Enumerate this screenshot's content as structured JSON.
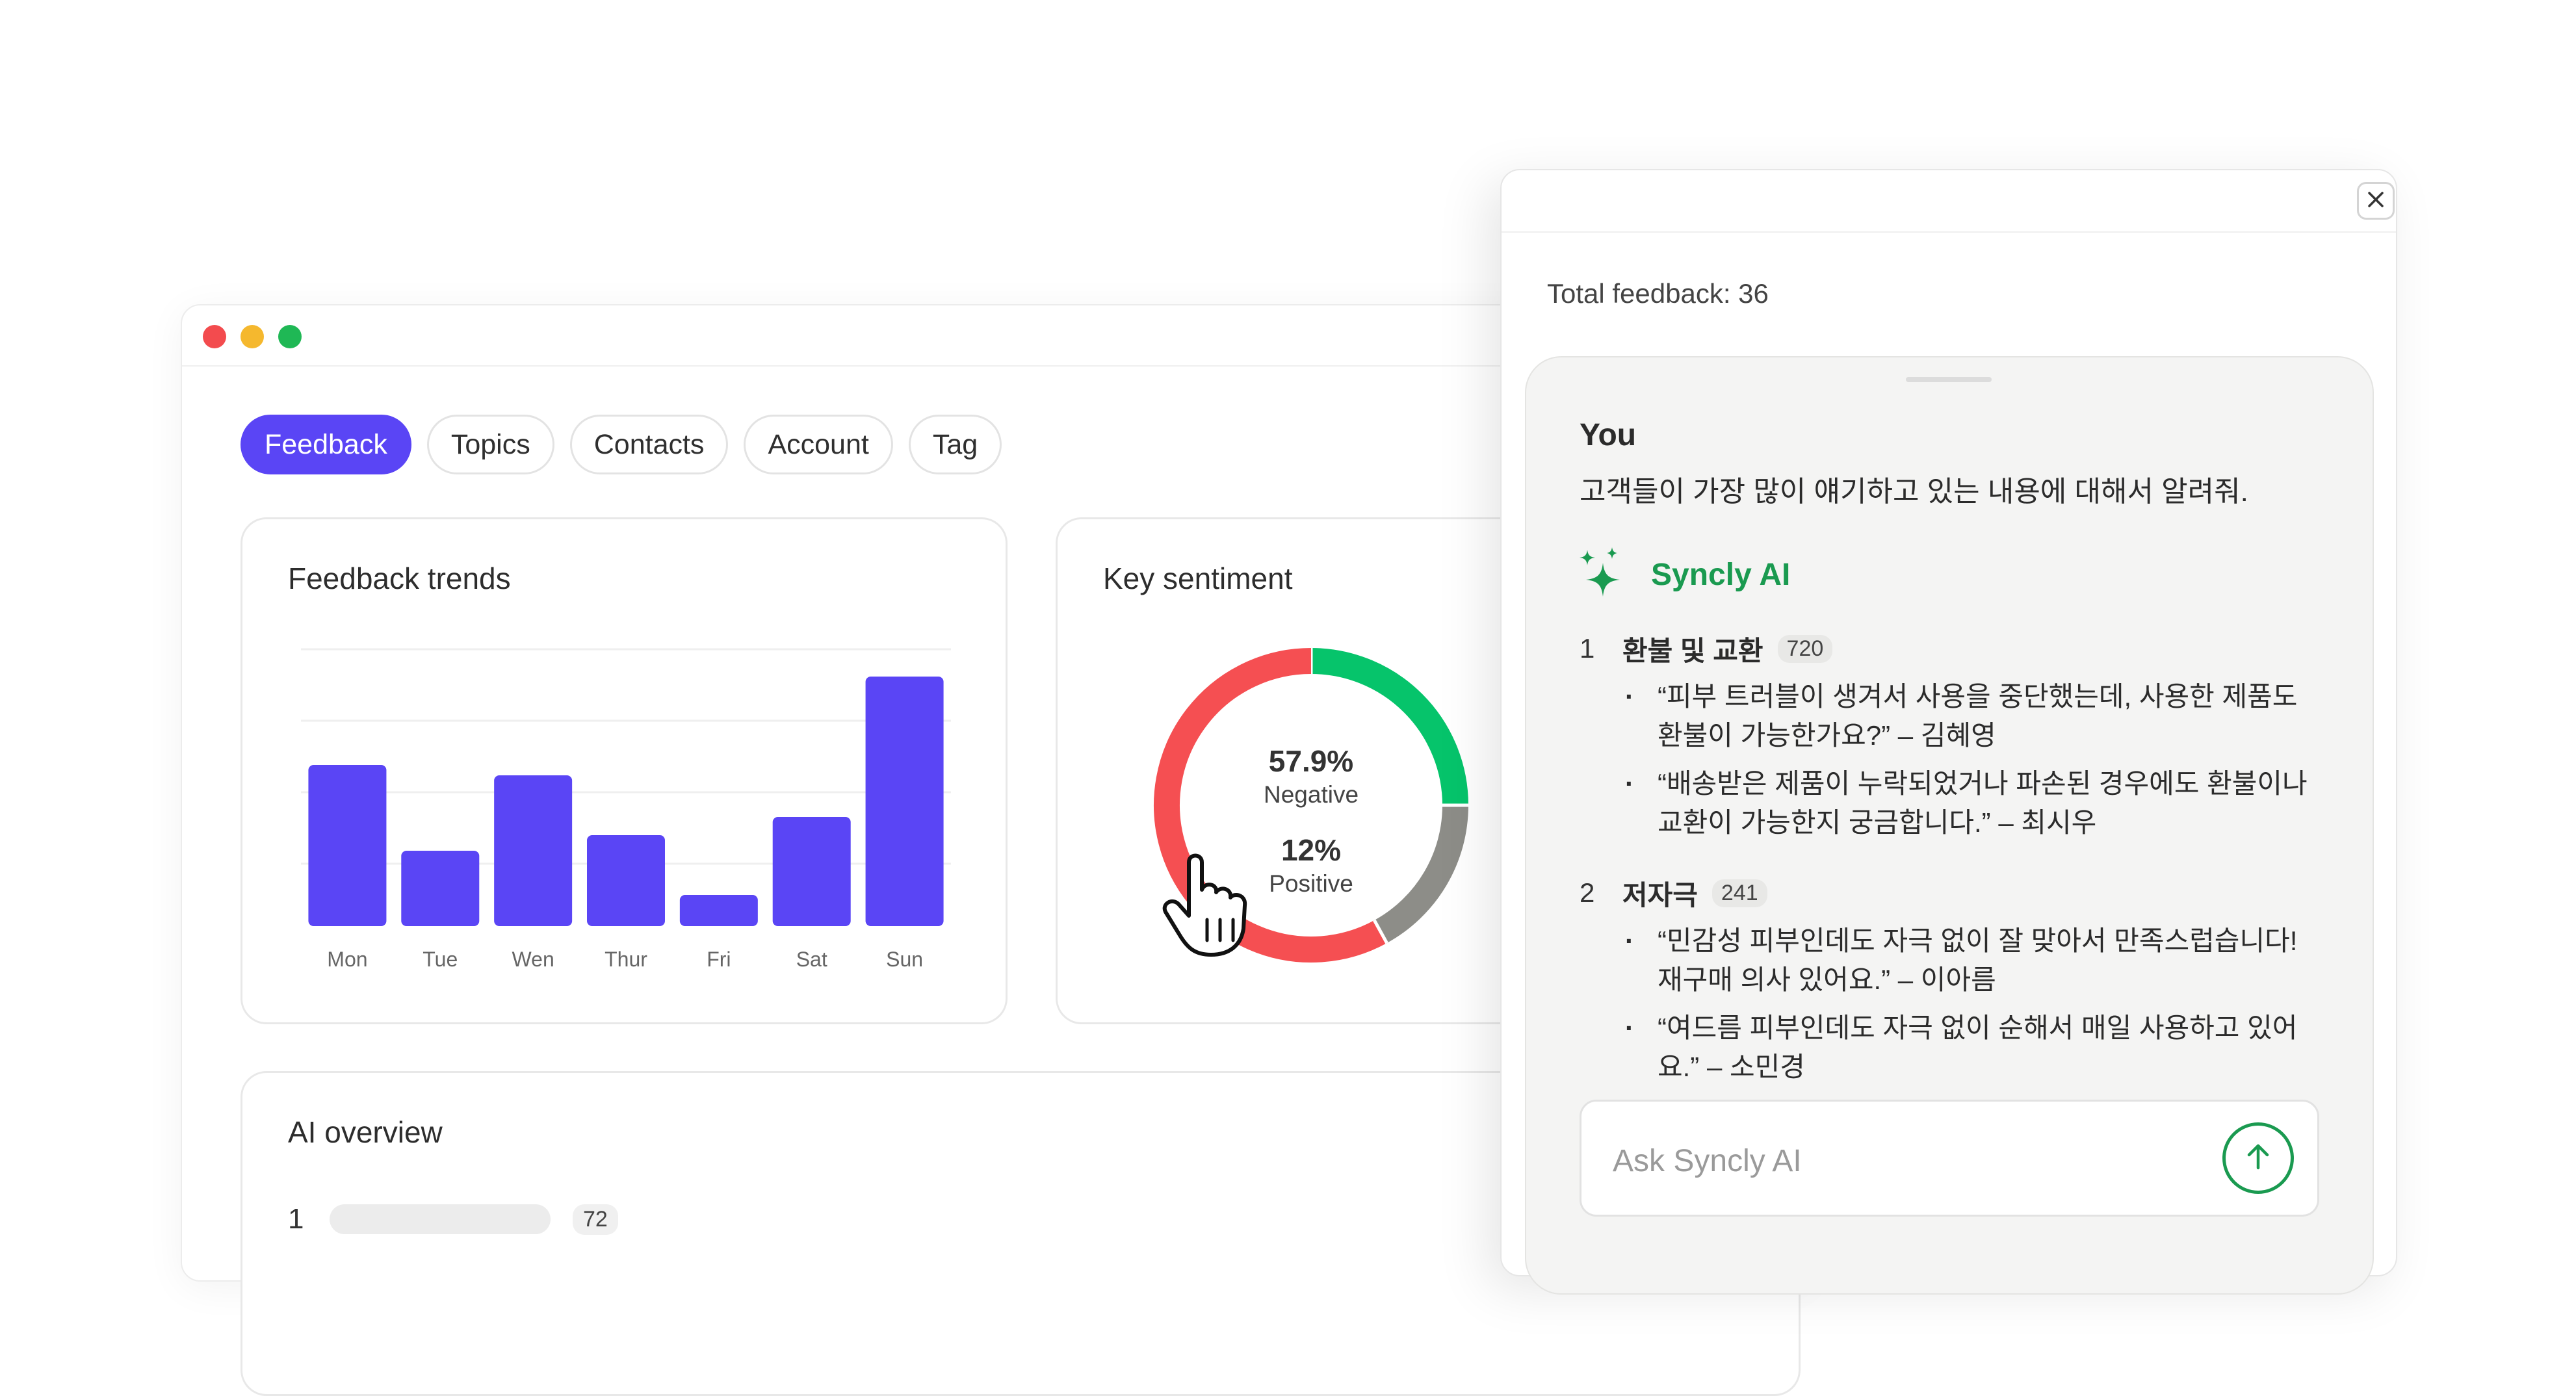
{
  "tabs": [
    {
      "label": "Feedback",
      "active": true
    },
    {
      "label": "Topics",
      "active": false
    },
    {
      "label": "Contacts",
      "active": false
    },
    {
      "label": "Account",
      "active": false
    },
    {
      "label": "Tag",
      "active": false
    }
  ],
  "colors": {
    "accent": "#5a45f5",
    "ai_green": "#1a9a50",
    "negative": "#f54f52",
    "positive": "#06c46b",
    "neutral": "#8d8d88"
  },
  "trends": {
    "title": "Feedback trends",
    "chart_data": {
      "type": "bar",
      "categories": [
        "Mon",
        "Tue",
        "Wen",
        "Thur",
        "Fri",
        "Sat",
        "Sun"
      ],
      "values": [
        62,
        29,
        58,
        35,
        12,
        42,
        96
      ],
      "ylim": [
        0,
        110
      ],
      "grid": true
    }
  },
  "sentiment": {
    "title": "Key sentiment",
    "chart_data": {
      "type": "pie",
      "segments": [
        {
          "label": "Positive",
          "value": 25
        },
        {
          "label": "Neutral",
          "value": 17
        },
        {
          "label": "Negative",
          "value": 58
        }
      ]
    },
    "negative_value": "57.9%",
    "negative_label": "Negative",
    "positive_value": "12%",
    "positive_label": "Positive",
    "cursor_icon": "hand-pointer-icon"
  },
  "overview": {
    "title": "AI overview",
    "rows": [
      {
        "rank": "1",
        "count": "72"
      }
    ]
  },
  "panel": {
    "close_label": "X",
    "total": "Total feedback: 36",
    "you_name": "You",
    "you_message": "고객들이 가장 많이 얘기하고 있는 내용에 대해서 알려줘.",
    "ai_icon": "sparkle-icon",
    "ai_name": "Syncly AI",
    "items": [
      {
        "num": "1",
        "title": "환불 및 교환",
        "count": "720",
        "quotes": [
          "“피부 트러블이 생겨서 사용을 중단했는데, 사용한 제품도 환불이 가능한가요?” – 김혜영",
          "“배송받은 제품이 누락되었거나 파손된 경우에도 환불이나 교환이 가능한지 궁금합니다.” – 최시우"
        ]
      },
      {
        "num": "2",
        "title": "저자극",
        "count": "241",
        "quotes": [
          "“민감성 피부인데도 자극 없이 잘 맞아서 만족스럽습니다! 재구매 의사 있어요.” – 이아름",
          "“여드름 피부인데도 자극 없이 순해서 매일 사용하고 있어요.” – 소민경"
        ]
      }
    ],
    "ask_placeholder": "Ask Syncly AI",
    "send_icon": "arrow-up-icon"
  }
}
